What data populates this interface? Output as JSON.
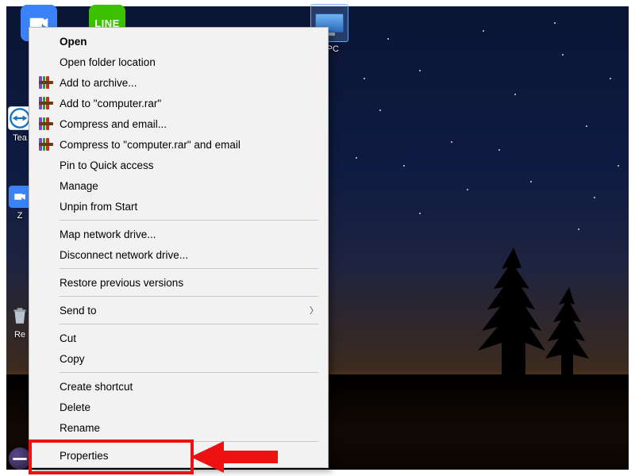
{
  "desktop": {
    "icons": {
      "zoom": {
        "label": "Z"
      },
      "line": {
        "label": "LINE"
      },
      "thispc": {
        "label": "s PC"
      },
      "teamviewer": {
        "label": "Tea"
      },
      "eclipse": {
        "label": ""
      },
      "other1": {
        "label": "Z"
      },
      "recycle": {
        "label": "Re"
      }
    }
  },
  "context_menu": {
    "open": "Open",
    "open_folder_location": "Open folder location",
    "add_to_archive": "Add to archive...",
    "add_to_computer_rar": "Add to \"computer.rar\"",
    "compress_and_email": "Compress and email...",
    "compress_to_computer_rar_email": "Compress to \"computer.rar\" and email",
    "pin_quick_access": "Pin to Quick access",
    "manage": "Manage",
    "unpin_start": "Unpin from Start",
    "map_network_drive": "Map network drive...",
    "disconnect_network_drive": "Disconnect network drive...",
    "restore_previous": "Restore previous versions",
    "send_to": "Send to",
    "cut": "Cut",
    "copy": "Copy",
    "create_shortcut": "Create shortcut",
    "delete": "Delete",
    "rename": "Rename",
    "properties": "Properties"
  },
  "annotation": {
    "highlight_target": "properties",
    "arrow_color": "#e11"
  }
}
